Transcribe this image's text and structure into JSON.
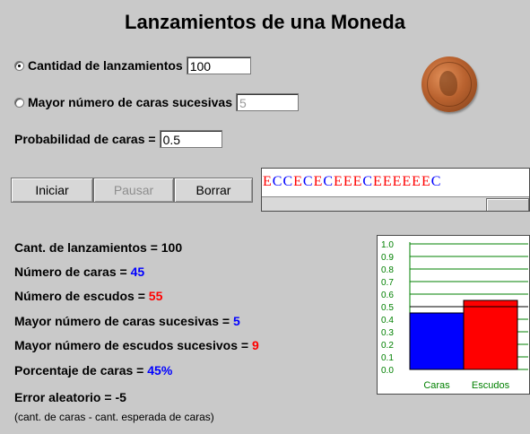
{
  "window": {
    "title": "Lanzamientos de una Moneda"
  },
  "options": {
    "launches_label": "Cantidad de lanzamientos",
    "launches_value": "100",
    "max_heads_label": "Mayor número de caras sucesivas",
    "max_heads_value": "5",
    "probability_label": "Probabilidad de caras =",
    "probability_value": "0.5",
    "selected_mode": "launches"
  },
  "buttons": {
    "start": "Iniciar",
    "pause": "Pausar",
    "clear": "Borrar"
  },
  "sequence": {
    "tokens": [
      "E",
      "C",
      "C",
      "E",
      "C",
      "E",
      "C",
      "E",
      "E",
      "E",
      "C",
      "E",
      "E",
      "E",
      "E",
      "E",
      "E",
      "C"
    ],
    "colors": {
      "C": "#0000ff",
      "E": "#ff0000"
    }
  },
  "stats": {
    "launches_label": "Cant. de lanzamientos = ",
    "launches_value": "100",
    "heads_label": "Número de caras = ",
    "heads_value": "45",
    "tails_label": "Número de escudos = ",
    "tails_value": "55",
    "max_heads_label": "Mayor número de caras sucesivas = ",
    "max_heads_value": "5",
    "max_tails_label": "Mayor número de escudos sucesivos = ",
    "max_tails_value": "9",
    "percent_label": "Porcentaje de caras = ",
    "percent_value": "45",
    "percent_sign": "%",
    "error_label": "Error aleatorio = ",
    "error_value": "-5",
    "note": "(cant. de caras - cant. esperada de caras)"
  },
  "colors": {
    "heads": "#0000ff",
    "tails": "#ff0000",
    "grid": "#008000",
    "background": "#c9c9c9"
  },
  "chart_data": {
    "type": "bar",
    "categories": [
      "Caras",
      "Escudos"
    ],
    "values": [
      0.45,
      0.55
    ],
    "expected": 0.5,
    "ylim": [
      0,
      1.0
    ],
    "yticks": [
      "0.0",
      "0.1",
      "0.2",
      "0.3",
      "0.4",
      "0.5",
      "0.6",
      "0.7",
      "0.8",
      "0.9",
      "1.0"
    ],
    "bar_colors": [
      "#0000ff",
      "#ff0000"
    ],
    "grid": true
  }
}
